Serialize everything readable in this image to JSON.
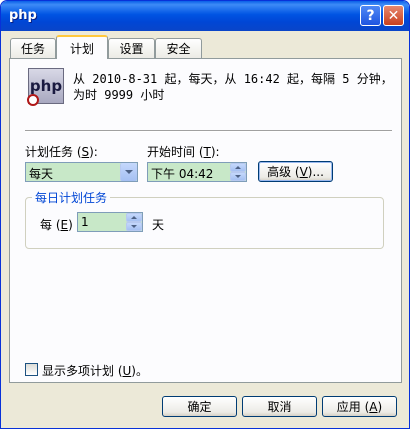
{
  "window": {
    "title": "php"
  },
  "titlebar": {
    "help_glyph": "?",
    "close_glyph": "✕"
  },
  "tabs": [
    {
      "label": "任务"
    },
    {
      "label": "计划"
    },
    {
      "label": "设置"
    },
    {
      "label": "安全"
    }
  ],
  "schedule": {
    "icon_text": "php",
    "summary": "从 2010-8-31 起，每天，从 16:42 起，每隔 5 分钟，为时 9999 小时",
    "task_label_pre": "计划任务 (",
    "task_label_key": "S",
    "task_label_post": "):",
    "task_value": "每天",
    "start_label_pre": "开始时间 (",
    "start_label_key": "T",
    "start_label_post": "):",
    "start_value": "下午 04:42",
    "advanced_pre": "高级 (",
    "advanced_key": "V",
    "advanced_post": ")..."
  },
  "daily": {
    "group_title": "每日计划任务",
    "every_pre": "每 (",
    "every_key": "E",
    "every_post": ")",
    "every_value": "1",
    "unit": "天"
  },
  "multiple": {
    "label_pre": "显示多项计划 (",
    "label_key": "U",
    "label_post": ")。",
    "checked": false
  },
  "footer": {
    "ok": "确定",
    "cancel": "取消",
    "apply_pre": "应用 (",
    "apply_key": "A",
    "apply_post": ")"
  },
  "colors": {
    "titlebar": "#0054e3",
    "active_tab_accent": "#ffc83c",
    "group_title": "#0046d5",
    "selected_field": "#c8e8c8"
  }
}
